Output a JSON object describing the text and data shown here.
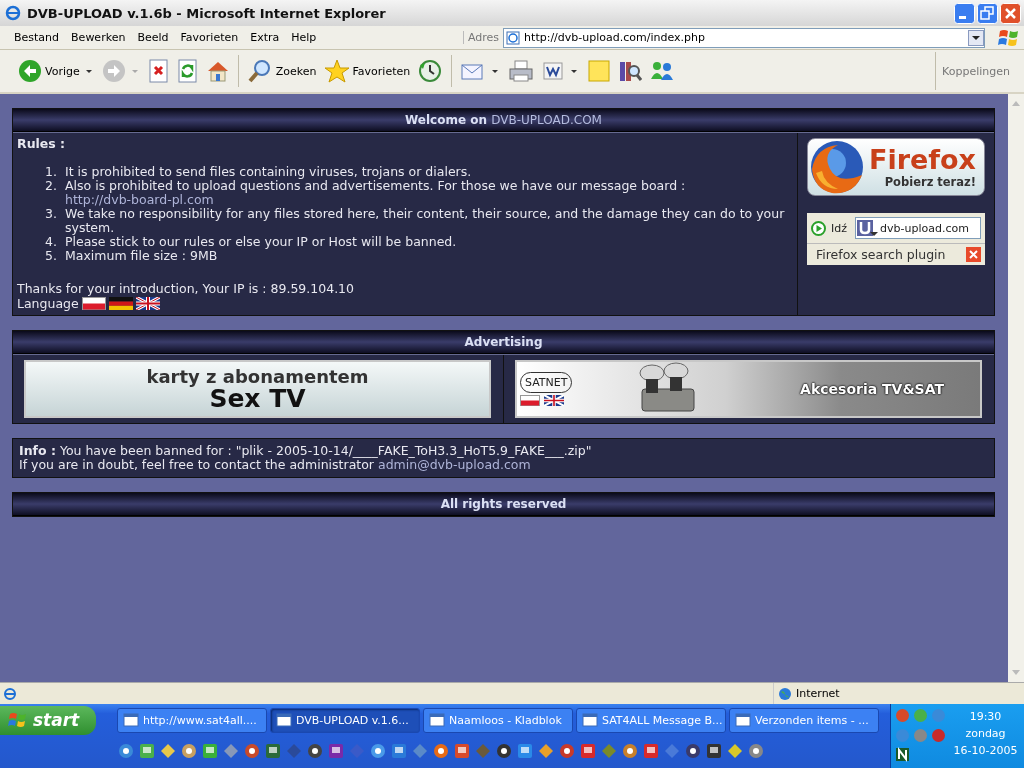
{
  "window": {
    "title": "DVB-UPLOAD v.1.6b - Microsoft Internet Explorer"
  },
  "menu": [
    "Bestand",
    "Bewerken",
    "Beeld",
    "Favorieten",
    "Extra",
    "Help"
  ],
  "address": {
    "label": "Adres",
    "url": "http://dvb-upload.com/index.php"
  },
  "toolbar": {
    "back": {
      "label": "Vorige"
    },
    "forward": {
      "disabled": true
    },
    "search": {
      "label": "Zoeken"
    },
    "favorites": {
      "label": "Favorieten"
    },
    "links": "Koppelingen"
  },
  "page": {
    "welcome": {
      "prefix": "Welcome on",
      "site": "DVB-UPLOAD.COM"
    },
    "rules_title": "Rules :",
    "rules": [
      {
        "num": "1.",
        "text": "It is prohibited to send files containing viruses, trojans or dialers."
      },
      {
        "num": "2.",
        "text": "Also is prohibited to upload questions and advertisements. For those we have our message board :",
        "link": "http://dvb-board-pl.com"
      },
      {
        "num": "3.",
        "text": "We take no responsibility for any files stored here, their content, their source, and the damage they can do to your system."
      },
      {
        "num": "4.",
        "text": "Please stick to our rules or else your IP or Host will be banned."
      },
      {
        "num": "5.",
        "text": "Maximum file size : 9MB"
      }
    ],
    "ip_line": "Thanks for your introduction, Your IP is : 89.59.104.10",
    "language_label": "Language",
    "firefox_banner": {
      "title": "Firefox",
      "subtitle": "Pobierz teraz!"
    },
    "search_plugin": {
      "go": "Idź",
      "value": "dvb-upload.com",
      "caption": "Firefox search plugin"
    },
    "advertising_title": "Advertising",
    "banners": [
      {
        "kind": "text",
        "line1": "karty z abonamentem",
        "line2": "Sex TV"
      },
      {
        "kind": "satnet",
        "brand": "SATNET",
        "text": "Akcesoria TV&SAT"
      }
    ],
    "info": {
      "label": "Info :",
      "text": "You have been banned for : \"plik - 2005-10-14/____FAKE_ToH3.3_HoT5.9_FAKE___.zip\"",
      "contact": "If you are in doubt, feel free to contact the administrator",
      "email": "admin@dvb-upload.com"
    },
    "footer": "All rights reserved"
  },
  "status_bar": {
    "zone": "Internet"
  },
  "taskbar": {
    "start": "start",
    "tasks": [
      {
        "label": "http://www.sat4all....",
        "selected": false
      },
      {
        "label": "DVB-UPLOAD v.1.6...",
        "selected": true
      },
      {
        "label": "Naamloos - Kladblok",
        "selected": false
      },
      {
        "label": "SAT4ALL Message B...",
        "selected": false
      },
      {
        "label": "Verzonden items - ...",
        "selected": false
      }
    ],
    "time": "19:30",
    "day": "zondag",
    "date": "16-10-2005"
  }
}
